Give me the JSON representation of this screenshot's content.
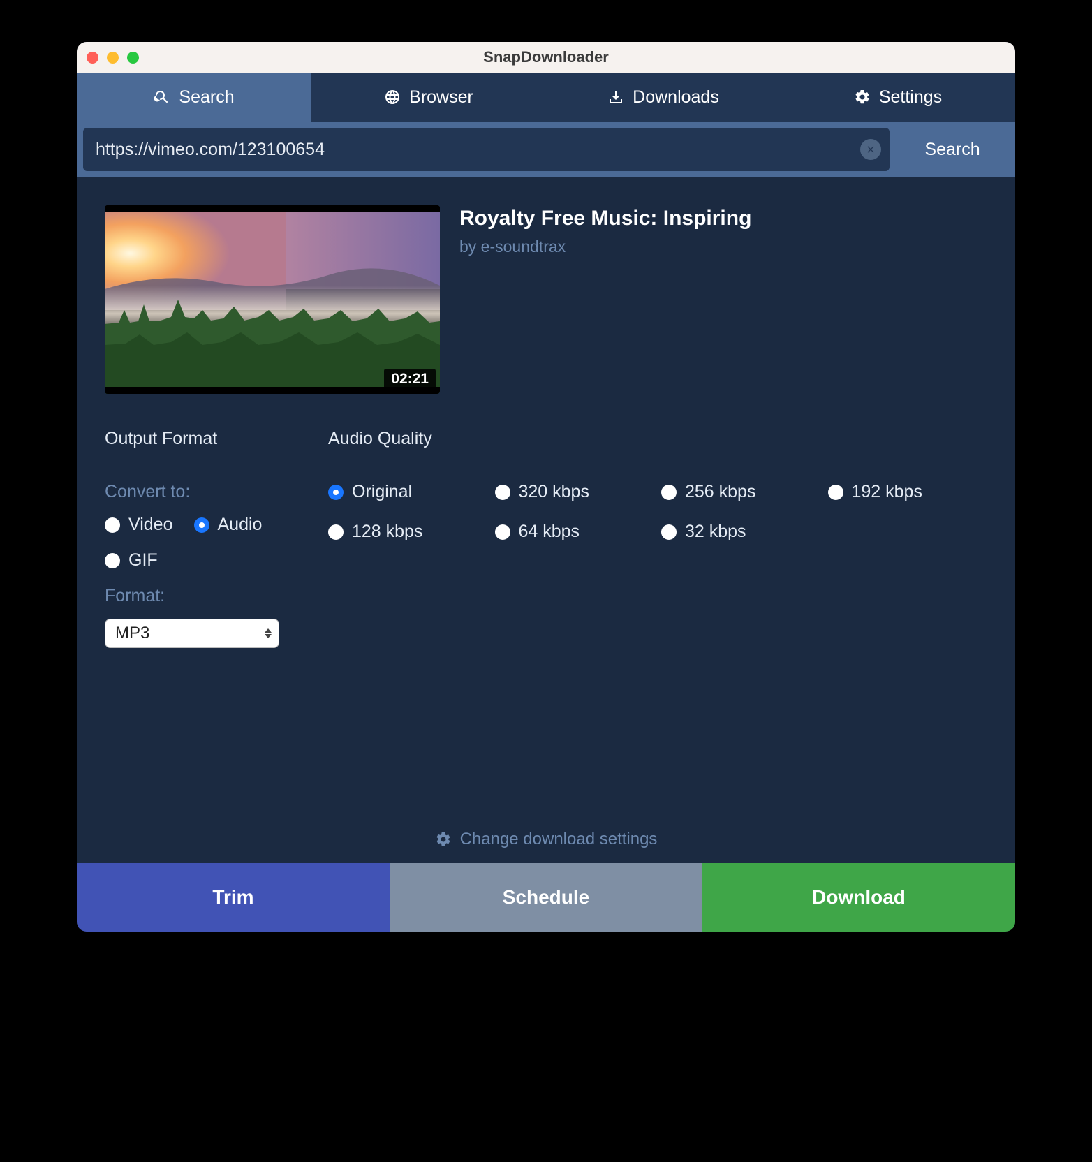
{
  "window": {
    "title": "SnapDownloader"
  },
  "tabs": {
    "search": "Search",
    "browser": "Browser",
    "downloads": "Downloads",
    "settings": "Settings",
    "active": "search"
  },
  "searchbar": {
    "value": "https://vimeo.com/123100654",
    "button": "Search"
  },
  "video": {
    "title": "Royalty Free Music: Inspiring",
    "author": "by e-soundtrax",
    "duration": "02:21"
  },
  "output_format": {
    "panel_title": "Output Format",
    "convert_label": "Convert to:",
    "options": {
      "video": "Video",
      "audio": "Audio",
      "gif": "GIF"
    },
    "selected": "audio",
    "format_label": "Format:",
    "format_value": "MP3"
  },
  "audio_quality": {
    "panel_title": "Audio Quality",
    "options": [
      "Original",
      "320 kbps",
      "256 kbps",
      "192 kbps",
      "128 kbps",
      "64 kbps",
      "32 kbps"
    ],
    "selected": "Original"
  },
  "change_settings": "Change download settings",
  "actions": {
    "trim": "Trim",
    "schedule": "Schedule",
    "download": "Download"
  }
}
